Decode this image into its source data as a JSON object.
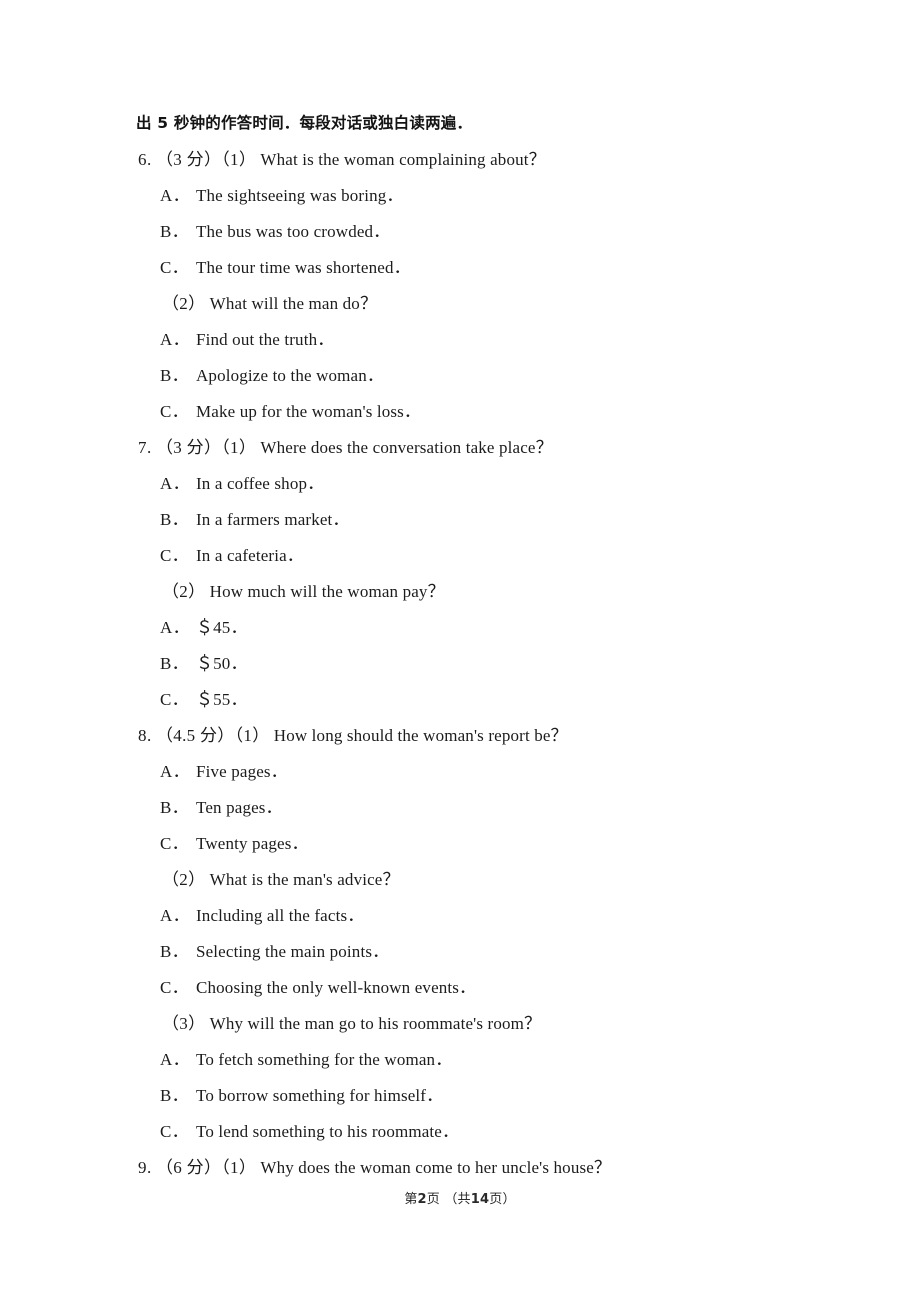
{
  "document": {
    "instruction": "出 5 秒钟的作答时间．每段对话或独白读两遍．",
    "footer": {
      "prefix": "第",
      "page_number": "2",
      "page_unit": "页",
      "total_open": "（共",
      "total_pages": "14",
      "total_unit": "页）",
      "full_text": "第2页 （共14页）"
    }
  },
  "questions": [
    {
      "number": "6.",
      "score": "（3 分）",
      "parts": [
        {
          "marker": "（1）",
          "stem": "What is the woman complaining about？",
          "options": [
            {
              "label": "A．",
              "text": "The sightseeing was boring．"
            },
            {
              "label": "B．",
              "text": "The bus was too crowded．"
            },
            {
              "label": "C．",
              "text": "The tour time was shortened．"
            }
          ]
        },
        {
          "marker": "（2）",
          "stem": "What will the man do？",
          "options": [
            {
              "label": "A．",
              "text": "Find out the truth．"
            },
            {
              "label": "B．",
              "text": "Apologize to the woman．"
            },
            {
              "label": "C．",
              "text": "Make up for the woman's loss．"
            }
          ]
        }
      ]
    },
    {
      "number": "7.",
      "score": "（3 分）",
      "parts": [
        {
          "marker": "（1）",
          "stem": "Where does the conversation take place？",
          "options": [
            {
              "label": "A．",
              "text": "In a coffee shop．"
            },
            {
              "label": "B．",
              "text": "In a farmers market．"
            },
            {
              "label": "C．",
              "text": "In a cafeteria．"
            }
          ]
        },
        {
          "marker": "（2）",
          "stem": "How much will the woman pay？",
          "options": [
            {
              "label": "A．",
              "text": "＄45．"
            },
            {
              "label": "B．",
              "text": "＄50．"
            },
            {
              "label": "C．",
              "text": "＄55．"
            }
          ]
        }
      ]
    },
    {
      "number": "8.",
      "score": "（4.5 分）",
      "parts": [
        {
          "marker": "（1）",
          "stem": "How long should the woman's report be？",
          "options": [
            {
              "label": "A．",
              "text": "Five pages．"
            },
            {
              "label": "B．",
              "text": "Ten pages．"
            },
            {
              "label": "C．",
              "text": "Twenty pages．"
            }
          ]
        },
        {
          "marker": "（2）",
          "stem": "What is the man's advice？",
          "options": [
            {
              "label": "A．",
              "text": "Including all the facts．"
            },
            {
              "label": "B．",
              "text": "Selecting the main points．"
            },
            {
              "label": "C．",
              "text": "Choosing the only well‐known events．"
            }
          ]
        },
        {
          "marker": "（3）",
          "stem": "Why will the man go to his roommate's room？",
          "options": [
            {
              "label": "A．",
              "text": "To fetch something for the woman．"
            },
            {
              "label": "B．",
              "text": "To borrow something for himself．"
            },
            {
              "label": "C．",
              "text": "To lend something to his roommate．"
            }
          ]
        }
      ]
    },
    {
      "number": "9.",
      "score": "（6 分）",
      "parts": [
        {
          "marker": "（1）",
          "stem": "Why does the woman come to her uncle's house？",
          "options": []
        }
      ]
    }
  ]
}
